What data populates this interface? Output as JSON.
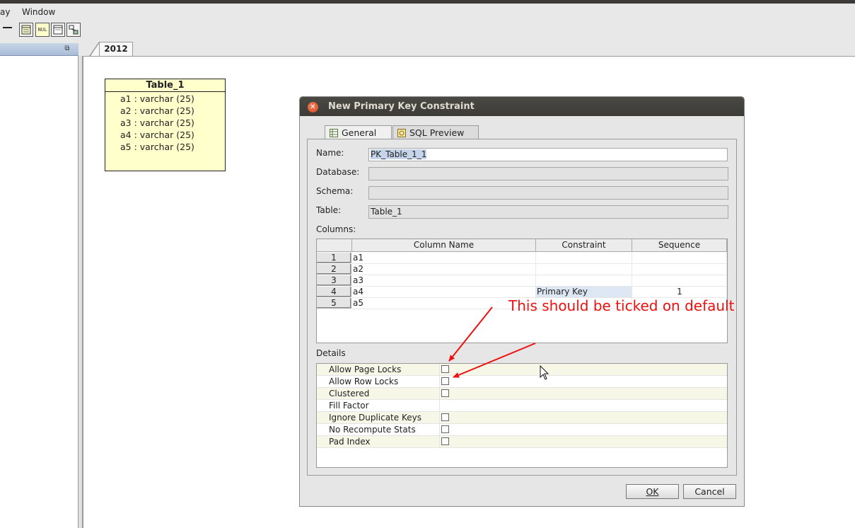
{
  "menubar": {
    "items": [
      "ay",
      "Window"
    ]
  },
  "toolbar": {
    "buttons": [
      "minimize-icon",
      "table-icon",
      "null-icon",
      "view-icon",
      "relation-icon"
    ],
    "null_text": "NUL"
  },
  "left_panel": {
    "restore_icon": "restore-icon"
  },
  "editor": {
    "tab_label": "2012"
  },
  "table_box": {
    "title": "Table_1",
    "columns": [
      "a1 : varchar (25)",
      "a2 : varchar (25)",
      "a3 : varchar (25)",
      "a4 : varchar (25)",
      "a5 : varchar (25)"
    ]
  },
  "dialog": {
    "title": "New Primary Key Constraint",
    "tabs": {
      "general": "General",
      "sql_preview": "SQL Preview"
    },
    "labels": {
      "name": "Name:",
      "database": "Database:",
      "schema": "Schema:",
      "table": "Table:",
      "columns": "Columns:",
      "details": "Details"
    },
    "fields": {
      "name": "PK_Table_1_1",
      "database": "",
      "schema": "",
      "table": "Table_1"
    },
    "grid": {
      "headers": [
        "Column Name",
        "Constraint",
        "Sequence"
      ],
      "rows": [
        {
          "num": "1",
          "name": "a1",
          "constraint": "",
          "sequence": ""
        },
        {
          "num": "2",
          "name": "a2",
          "constraint": "",
          "sequence": ""
        },
        {
          "num": "3",
          "name": "a3",
          "constraint": "",
          "sequence": ""
        },
        {
          "num": "4",
          "name": "a4",
          "constraint": "Primary Key",
          "sequence": "1"
        },
        {
          "num": "5",
          "name": "a5",
          "constraint": "",
          "sequence": ""
        }
      ]
    },
    "details": [
      {
        "name": "Allow Page Locks",
        "checkbox": true,
        "checked": false
      },
      {
        "name": "Allow Row Locks",
        "checkbox": true,
        "checked": false
      },
      {
        "name": "Clustered",
        "checkbox": true,
        "checked": false
      },
      {
        "name": "Fill Factor",
        "checkbox": false,
        "value": ""
      },
      {
        "name": "Ignore Duplicate Keys",
        "checkbox": true,
        "checked": false
      },
      {
        "name": "No Recompute Stats",
        "checkbox": true,
        "checked": false
      },
      {
        "name": "Pad Index",
        "checkbox": true,
        "checked": false
      }
    ],
    "buttons": {
      "ok": "OK",
      "cancel": "Cancel"
    }
  },
  "annotation": {
    "text": "This should be ticked on default",
    "color": "#ee1111"
  }
}
